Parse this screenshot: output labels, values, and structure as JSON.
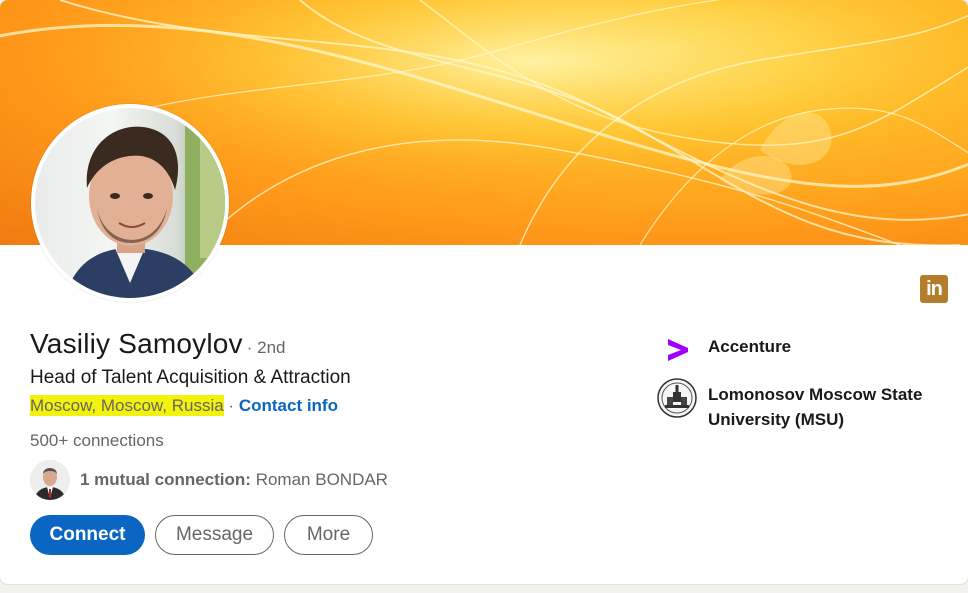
{
  "profile": {
    "name": "Vasiliy Samoylov",
    "degree": "· 2nd",
    "headline": "Head of Talent Acquisition & Attraction",
    "location": "Moscow, Moscow, Russia",
    "separator": "·",
    "contact_label": "Contact info",
    "connections": "500+ connections"
  },
  "mutual": {
    "count_label": "1 mutual connection:",
    "name": "Roman BONDAR"
  },
  "actions": {
    "connect": "Connect",
    "message": "Message",
    "more": "More"
  },
  "orgs": [
    {
      "name": "Accenture",
      "icon": "accenture-logo-icon"
    },
    {
      "name": "Lomonosov Moscow State University (MSU)",
      "icon": "msu-logo-icon"
    }
  ],
  "badge": {
    "label": "in",
    "icon": "linkedin-icon"
  },
  "colors": {
    "primary": "#0a66c2",
    "highlight": "#f2f20c",
    "accenture": "#a100ff",
    "banner_orange": "#f07a10"
  }
}
